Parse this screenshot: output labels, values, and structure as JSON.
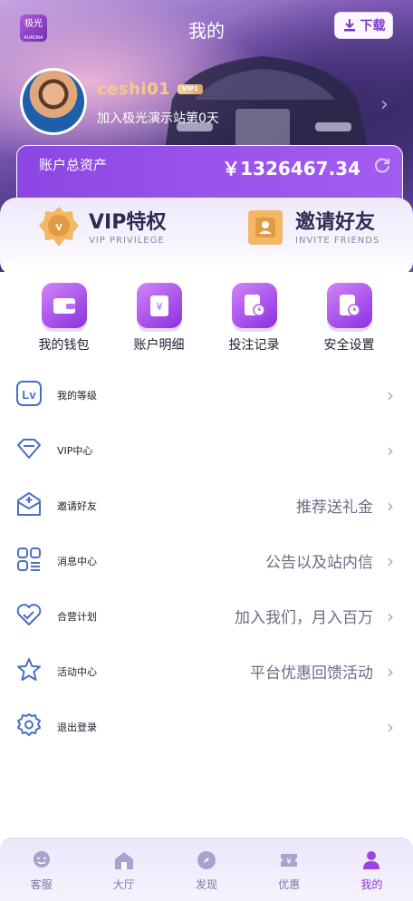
{
  "header": {
    "logo_text": "极光",
    "logo_sub": "AURORA",
    "title": "我的",
    "download_label": "下载"
  },
  "profile": {
    "username": "ceshi01",
    "vip_level": "VIP1",
    "join_text": "加入极光演示站第0天"
  },
  "assets": {
    "label": "账户总资产",
    "value": "￥1326467.34"
  },
  "privileges": [
    {
      "title": "VIP特权",
      "subtitle": "VIP PRIVILEGE"
    },
    {
      "title": "邀请好友",
      "subtitle": "INVITE FRIENDS"
    }
  ],
  "quick_actions": [
    {
      "label": "我的钱包",
      "icon": "wallet-icon"
    },
    {
      "label": "账户明细",
      "icon": "ledger-icon"
    },
    {
      "label": "投注记录",
      "icon": "bet-record-icon"
    },
    {
      "label": "安全设置",
      "icon": "security-icon"
    }
  ],
  "menu": [
    {
      "label": "我的等级",
      "desc": "",
      "icon": "level-icon"
    },
    {
      "label": "VIP中心",
      "desc": "",
      "icon": "diamond-icon"
    },
    {
      "label": "邀请好友",
      "desc": "推荐送礼金",
      "icon": "invite-icon"
    },
    {
      "label": "消息中心",
      "desc": "公告以及站内信",
      "icon": "message-icon"
    },
    {
      "label": "合营计划",
      "desc": "加入我们，月入百万",
      "icon": "partner-icon"
    },
    {
      "label": "活动中心",
      "desc": "平台优惠回馈活动",
      "icon": "star-icon"
    },
    {
      "label": "退出登录",
      "desc": "",
      "icon": "gear-icon"
    }
  ],
  "bottom_nav": [
    {
      "label": "客服",
      "icon": "service-icon"
    },
    {
      "label": "大厅",
      "icon": "home-icon"
    },
    {
      "label": "发现",
      "icon": "compass-icon"
    },
    {
      "label": "优惠",
      "icon": "ticket-icon"
    },
    {
      "label": "我的",
      "icon": "user-icon",
      "active": true
    }
  ],
  "colors": {
    "accent": "#9a53ea",
    "username": "#f6c987",
    "active_nav": "#8b35d8"
  }
}
